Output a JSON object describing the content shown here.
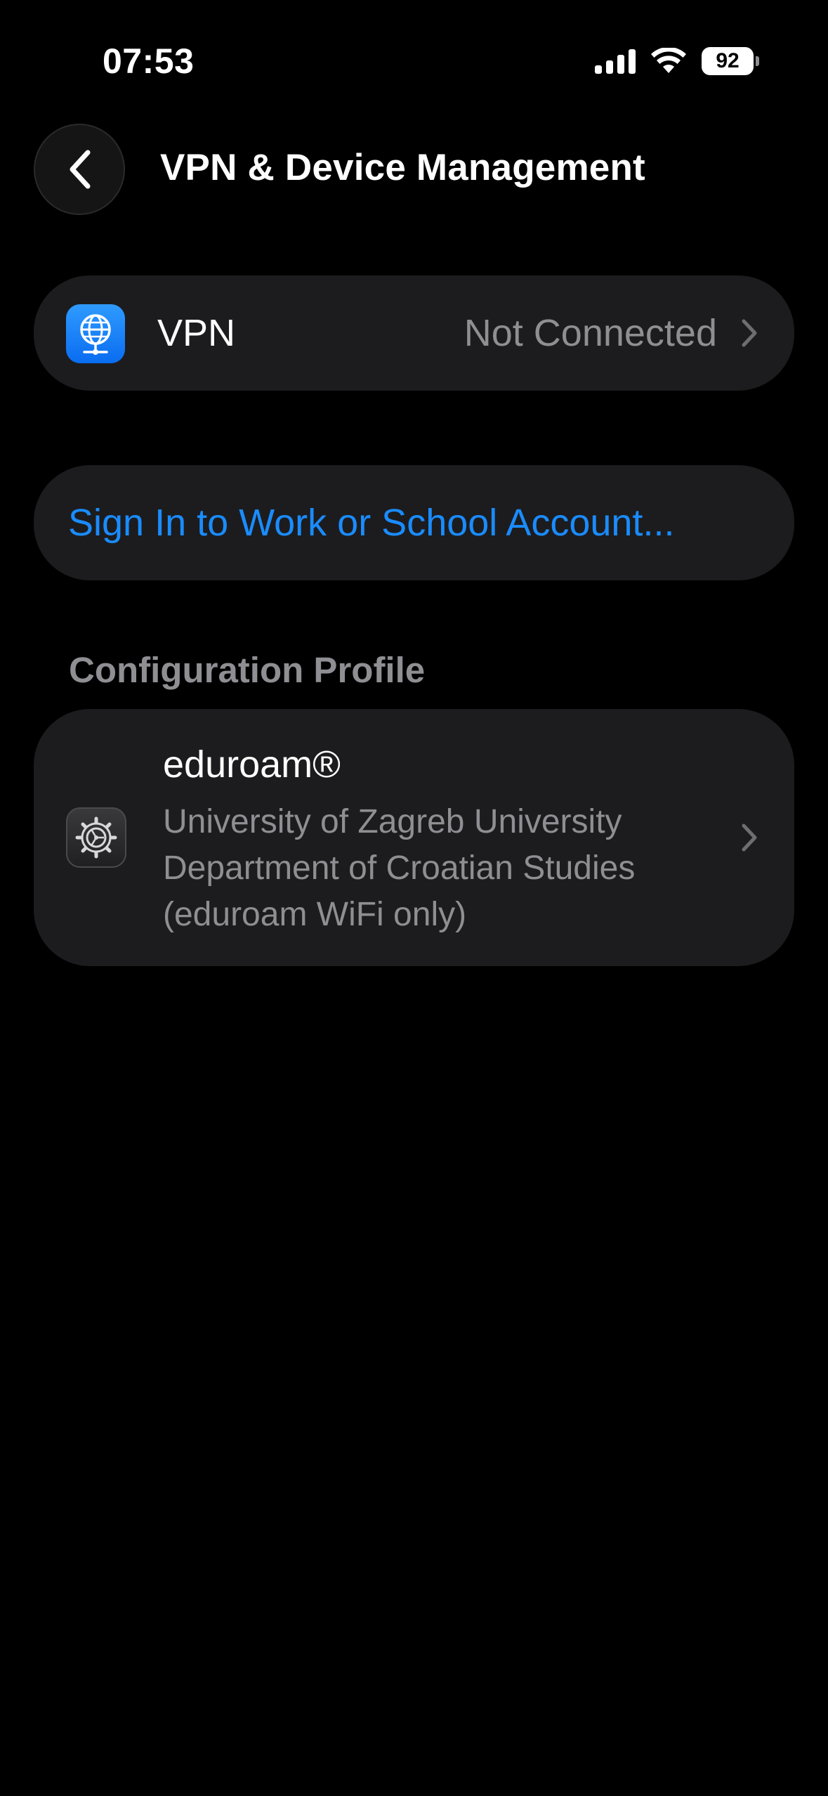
{
  "status_bar": {
    "time": "07:53",
    "battery_level": "92",
    "signal_icon": "cellular-signal-icon",
    "wifi_icon": "wifi-icon"
  },
  "nav": {
    "back_icon": "chevron-left-icon",
    "title": "VPN & Device Management"
  },
  "vpn": {
    "label": "VPN",
    "status": "Not Connected",
    "icon": "vpn-globe-icon"
  },
  "sign_in": {
    "label": "Sign In to Work or School Account..."
  },
  "configuration_profile": {
    "header": "Configuration Profile",
    "items": [
      {
        "name": "eduroam®",
        "description_lines": [
          "University of Zagreb University",
          "Department of Croatian Studies",
          "(eduroam WiFi only)"
        ],
        "icon": "settings-gear-icon"
      }
    ]
  },
  "colors": {
    "background": "#000000",
    "card": "#1c1c1e",
    "accent_blue": "#1a8cff",
    "secondary_text": "#8e8e93"
  }
}
